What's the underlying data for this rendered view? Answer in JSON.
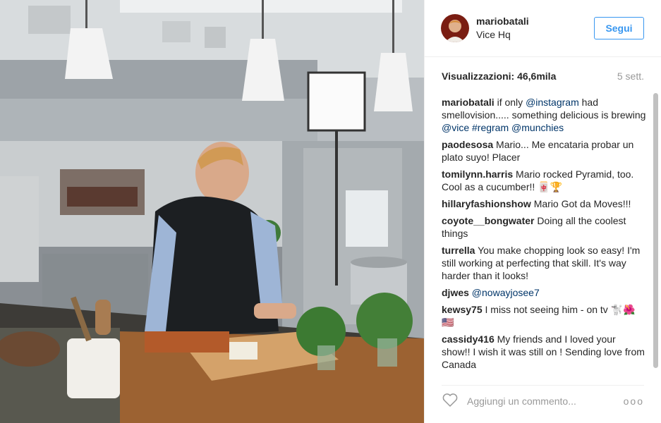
{
  "post": {
    "username": "mariobatali",
    "location": "Vice Hq",
    "follow_label": "Segui",
    "views": "Visualizzazioni: 46,6mila",
    "age": "5 sett."
  },
  "comments": [
    {
      "user": "mariobatali",
      "parts": [
        {
          "t": "if only "
        },
        {
          "t": "@instagram",
          "tag": true
        },
        {
          "t": " had smellovision..... something delicious is brewing "
        },
        {
          "t": "@vice",
          "tag": true
        },
        {
          "t": " "
        },
        {
          "t": "#regram",
          "tag": true
        },
        {
          "t": " "
        },
        {
          "t": "@munchies",
          "tag": true
        }
      ]
    },
    {
      "user": "paodesosa",
      "parts": [
        {
          "t": "Mario... Me encataria probar un plato suyo! Placer"
        }
      ]
    },
    {
      "user": "tomilynn.harris",
      "parts": [
        {
          "t": "Mario rocked Pyramid, too. Cool as a cucumber!! 🀄🏆"
        }
      ]
    },
    {
      "user": "hillaryfashionshow",
      "parts": [
        {
          "t": "Mario Got da Moves!!!"
        }
      ]
    },
    {
      "user": "coyote__bongwater",
      "parts": [
        {
          "t": "Doing all the coolest things"
        }
      ]
    },
    {
      "user": "turrella",
      "parts": [
        {
          "t": "You make chopping look so easy! I'm still working at perfecting that skill. It's way harder than it looks!"
        }
      ]
    },
    {
      "user": "djwes",
      "parts": [
        {
          "t": "@nowayjosee7",
          "tag": true
        }
      ]
    },
    {
      "user": "kewsy75",
      "parts": [
        {
          "t": "I miss not seeing him - on tv 🐩🌺🇺🇸"
        }
      ]
    },
    {
      "user": "cassidy416",
      "parts": [
        {
          "t": "My friends and I loved your show!! I wish it was still on ! Sending love from Canada"
        }
      ]
    }
  ],
  "composer": {
    "placeholder": "Aggiungi un commento...",
    "more": "ooo"
  },
  "colors": {
    "accent": "#3897f0",
    "tag": "#003569",
    "muted": "#999999"
  }
}
